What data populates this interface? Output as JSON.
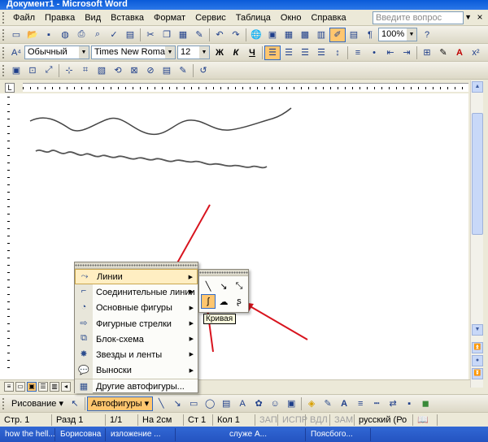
{
  "window": {
    "title": "Документ1 - Microsoft Word"
  },
  "menu": {
    "items": [
      "Файл",
      "Правка",
      "Вид",
      "Вставка",
      "Формат",
      "Сервис",
      "Таблица",
      "Окно",
      "Справка"
    ],
    "help_placeholder": "Введите вопрос"
  },
  "standard_toolbar": {
    "zoom": "100%"
  },
  "formatting_toolbar": {
    "style": "Обычный",
    "font": "Times New Roman",
    "size": "12",
    "bold": "Ж",
    "italic": "К",
    "underline": "Ч"
  },
  "drawing_toolbar": {
    "drawing_label": "Рисование",
    "autoshapes_label": "Автофигуры"
  },
  "autoshapes_menu": {
    "items": [
      {
        "label": "Линии",
        "icon": "lines-icon",
        "has_submenu": true,
        "highlighted": true
      },
      {
        "label": "Соединительные линии",
        "icon": "connectors-icon",
        "has_submenu": true
      },
      {
        "label": "Основные фигуры",
        "icon": "basic-shapes-icon",
        "has_submenu": true
      },
      {
        "label": "Фигурные стрелки",
        "icon": "block-arrows-icon",
        "has_submenu": true
      },
      {
        "label": "Блок-схема",
        "icon": "flowchart-icon",
        "has_submenu": true
      },
      {
        "label": "Звезды и ленты",
        "icon": "stars-icon",
        "has_submenu": true
      },
      {
        "label": "Выноски",
        "icon": "callouts-icon",
        "has_submenu": true
      },
      {
        "label": "Другие автофигуры...",
        "icon": "more-shapes-icon",
        "has_submenu": false
      }
    ]
  },
  "lines_submenu": {
    "tooltip": "Кривая",
    "selected": "curve-tool"
  },
  "status_bar": {
    "page": "Стр. 1",
    "section": "Разд 1",
    "pages": "1/1",
    "at": "На 2см",
    "line": "Ст 1",
    "col": "Кол 1",
    "rec": "ЗАП",
    "trk": "ИСПР",
    "ext": "ВДЛ",
    "ovr": "ЗАМ",
    "lang": "русский (Ро"
  },
  "taskbar": {
    "items": [
      "how the hell...",
      "Борисовна",
      "изложение ...",
      "служе А...",
      "Поясбого..."
    ]
  }
}
